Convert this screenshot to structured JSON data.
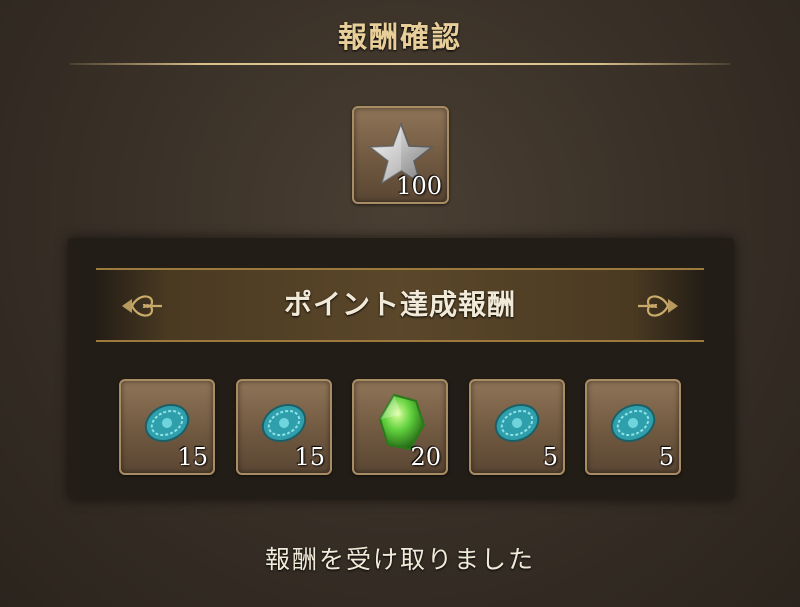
{
  "dialog": {
    "title": "報酬確認",
    "top_reward": {
      "icon": "silver-star-icon",
      "quantity": "100"
    },
    "banner_label": "ポイント達成報酬",
    "rewards": [
      {
        "icon": "teal-crest-icon",
        "quantity": "15"
      },
      {
        "icon": "teal-crest-icon",
        "quantity": "15"
      },
      {
        "icon": "green-gem-icon",
        "quantity": "20"
      },
      {
        "icon": "teal-crest-icon",
        "quantity": "5"
      },
      {
        "icon": "teal-crest-icon",
        "quantity": "5"
      }
    ],
    "footer_message": "報酬を受け取りました"
  },
  "colors": {
    "title": "#e8cf9a",
    "banner_border": "#9c7a3e",
    "slot_border": "#a88c64",
    "crest": "#3fb6bf",
    "gem": "#5fcf3c"
  }
}
